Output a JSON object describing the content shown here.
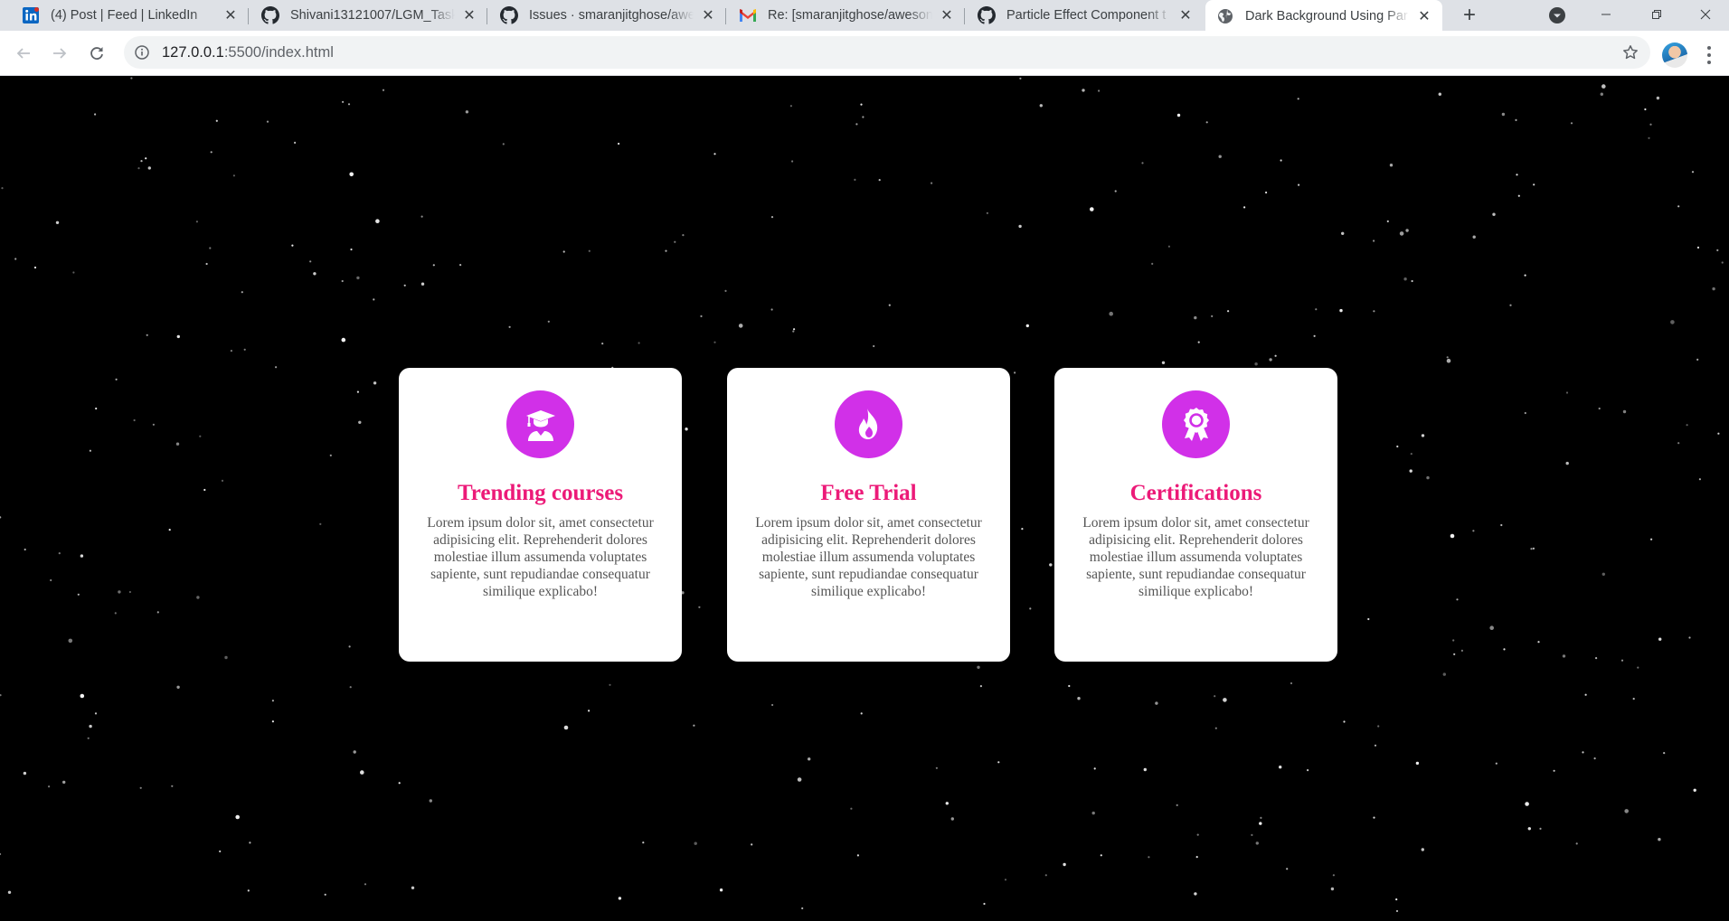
{
  "browser": {
    "tabs": [
      {
        "title": "(4) Post | Feed | LinkedIn",
        "icon": "linkedin-icon",
        "active": false
      },
      {
        "title": "Shivani13121007/LGM_Task",
        "icon": "github-icon",
        "active": false
      },
      {
        "title": "Issues · smaranjitghose/awe",
        "icon": "github-icon",
        "active": false
      },
      {
        "title": "Re: [smaranjitghose/aweson",
        "icon": "gmail-icon",
        "active": false
      },
      {
        "title": "Particle Effect Component t",
        "icon": "github-icon",
        "active": false
      },
      {
        "title": "Dark Background Using Par",
        "icon": "globe-icon",
        "active": true
      }
    ],
    "url_host": "127.0.0.1",
    "url_path": ":5500/index.html",
    "colors": {
      "tabstrip": "#dee1e6",
      "toolbar": "#ffffff",
      "omnibox": "#f1f3f4"
    }
  },
  "page": {
    "background": "#000000",
    "accent": "#d130e8",
    "title_color": "#ec1a78",
    "cards": [
      {
        "icon": "graduate-icon",
        "title": "Trending courses",
        "text": "Lorem ipsum dolor sit, amet consectetur adipisicing elit. Reprehenderit dolores molestiae illum assumenda voluptates sapiente, sunt repudiandae consequatur similique explicabo!"
      },
      {
        "icon": "fire-icon",
        "title": "Free Trial",
        "text": "Lorem ipsum dolor sit, amet consectetur adipisicing elit. Reprehenderit dolores molestiae illum assumenda voluptates sapiente, sunt repudiandae consequatur similique explicabo!"
      },
      {
        "icon": "award-icon",
        "title": "Certifications",
        "text": "Lorem ipsum dolor sit, amet consectetur adipisicing elit. Reprehenderit dolores molestiae illum assumenda voluptates sapiente, sunt repudiandae consequatur similique explicabo!"
      }
    ]
  }
}
